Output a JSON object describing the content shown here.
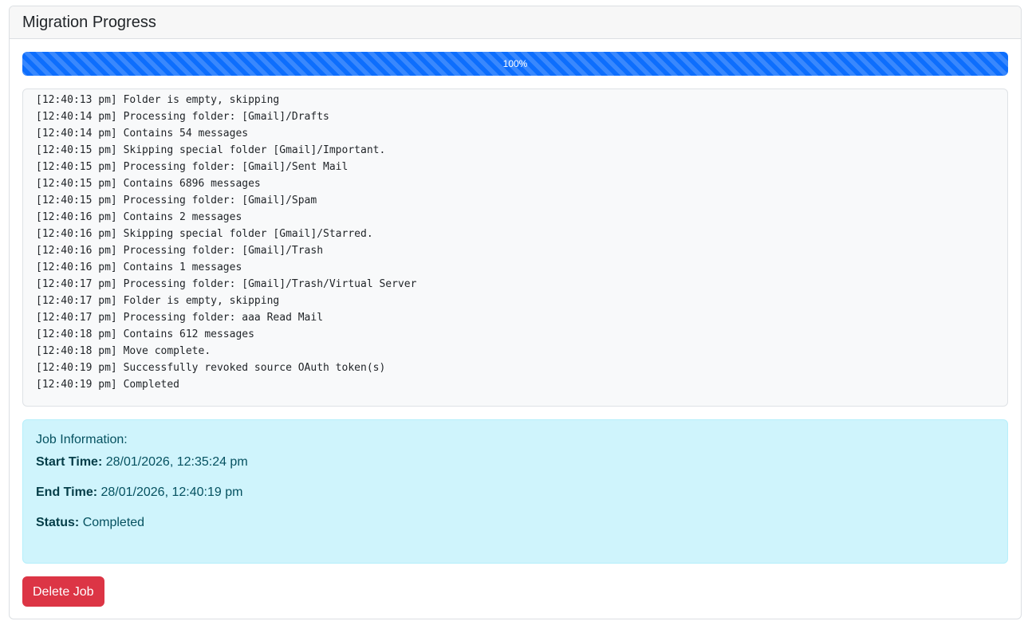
{
  "card": {
    "title": "Migration Progress"
  },
  "progress": {
    "value": 100,
    "label": "100%",
    "color": "#0d6efd"
  },
  "log": {
    "lines": [
      "[12:40:13 pm] Folder is empty, skipping",
      "[12:40:14 pm] Processing folder: [Gmail]/Drafts",
      "[12:40:14 pm] Contains 54 messages",
      "[12:40:15 pm] Skipping special folder [Gmail]/Important.",
      "[12:40:15 pm] Processing folder: [Gmail]/Sent Mail",
      "[12:40:15 pm] Contains 6896 messages",
      "[12:40:15 pm] Processing folder: [Gmail]/Spam",
      "[12:40:16 pm] Contains 2 messages",
      "[12:40:16 pm] Skipping special folder [Gmail]/Starred.",
      "[12:40:16 pm] Processing folder: [Gmail]/Trash",
      "[12:40:16 pm] Contains 1 messages",
      "[12:40:17 pm] Processing folder: [Gmail]/Trash/Virtual Server",
      "[12:40:17 pm] Folder is empty, skipping",
      "[12:40:17 pm] Processing folder: aaa Read Mail",
      "[12:40:18 pm] Contains 612 messages",
      "[12:40:18 pm] Move complete.",
      "[12:40:19 pm] Successfully revoked source OAuth token(s)",
      "[12:40:19 pm] Completed"
    ]
  },
  "job_info": {
    "title": "Job Information:",
    "start_label": "Start Time:",
    "start_value": "28/01/2026, 12:35:24 pm",
    "end_label": "End Time:",
    "end_value": "28/01/2026, 12:40:19 pm",
    "status_label": "Status:",
    "status_value": "Completed",
    "bg_color": "#cff4fc",
    "text_color": "#055160"
  },
  "actions": {
    "delete_label": "Delete Job",
    "delete_color": "#dc3545"
  }
}
